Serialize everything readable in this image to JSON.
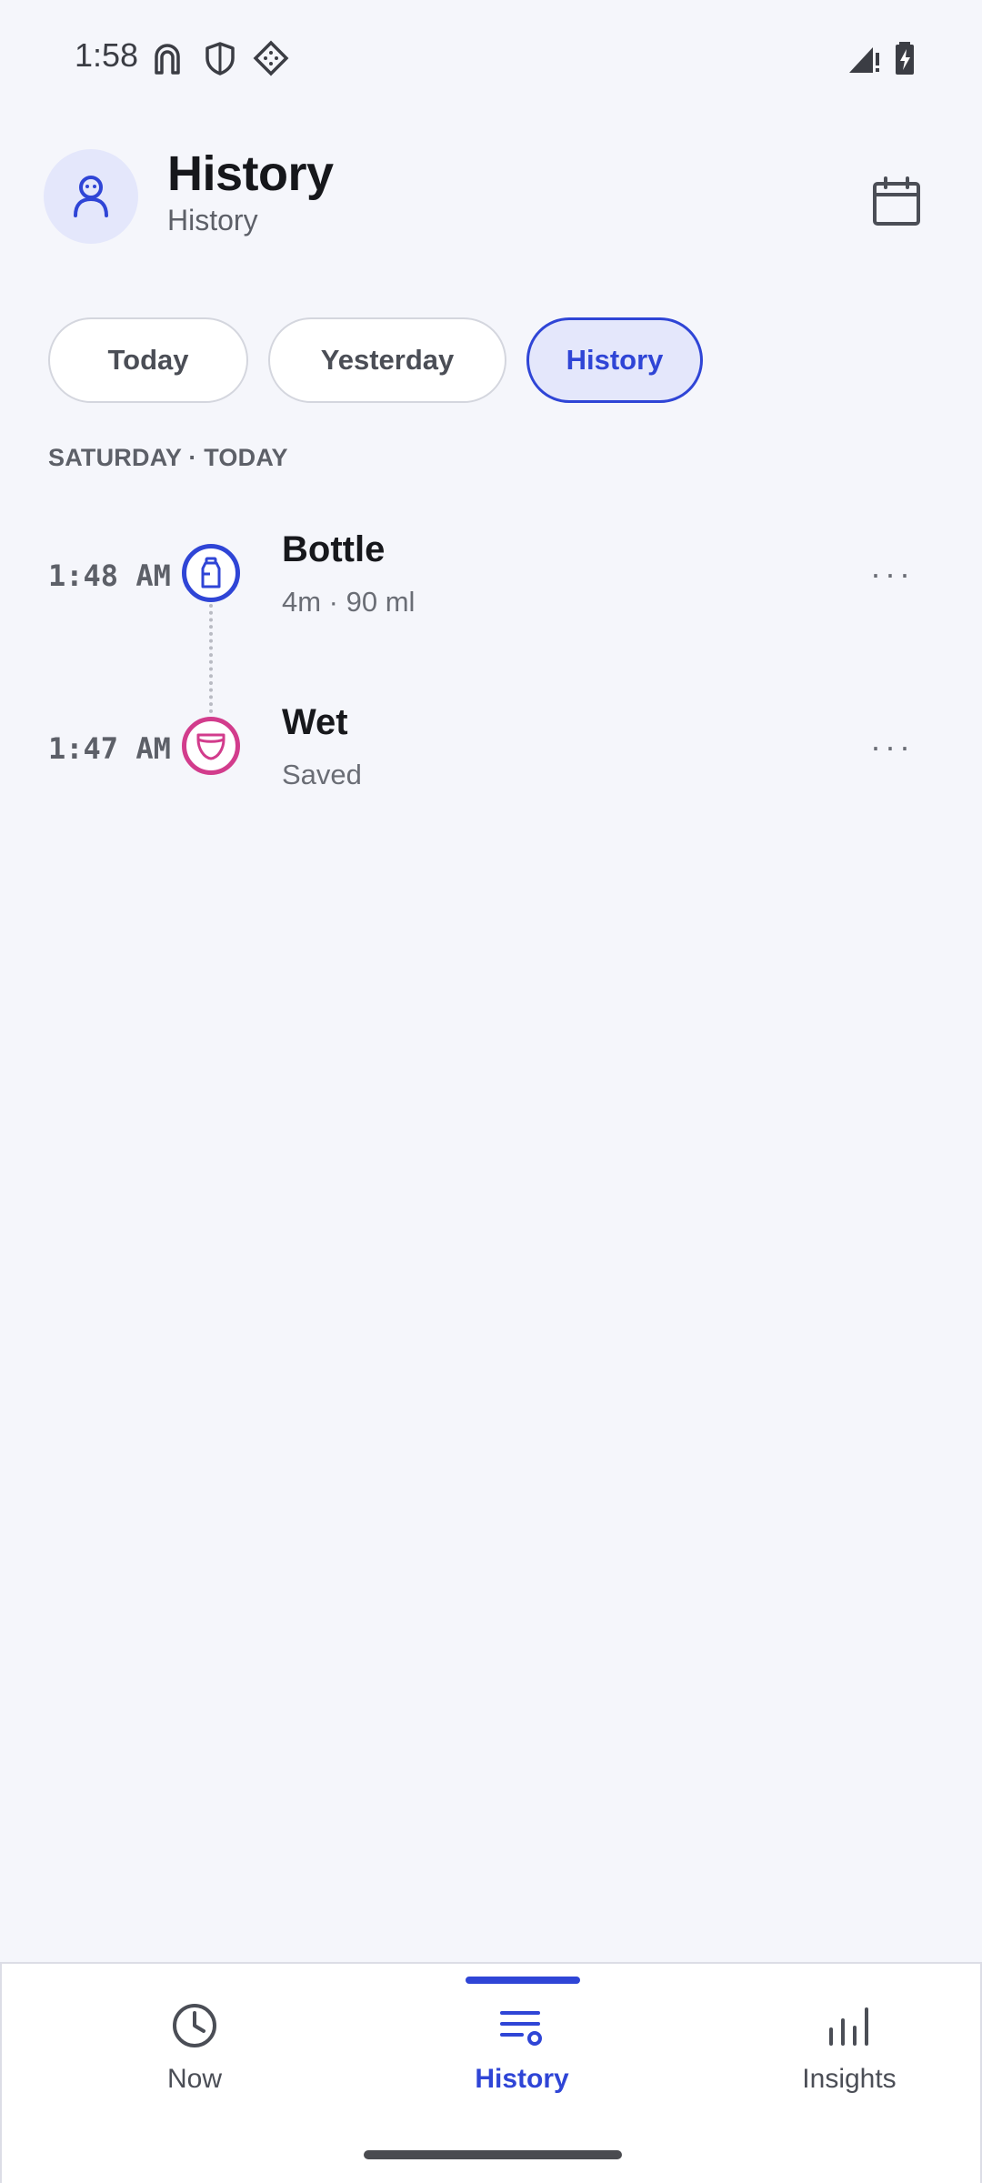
{
  "status_bar": {
    "time": "1:58",
    "icons": [
      "notification-arch-icon",
      "shield-icon",
      "diamond-dots-icon",
      "signal-icon",
      "battery-charging-icon"
    ]
  },
  "header": {
    "title": "History",
    "subtitle": "History",
    "avatar_icon": "baby-avatar-icon",
    "calendar_icon": "calendar-icon"
  },
  "filters": {
    "chips": [
      {
        "label": "Today",
        "active": false
      },
      {
        "label": "Yesterday",
        "active": false
      },
      {
        "label": "History",
        "active": true
      }
    ]
  },
  "timeline": {
    "section_title": "SATURDAY · TODAY",
    "entries": [
      {
        "time": "1:48 AM",
        "title": "Bottle",
        "detail": "4m · 90 ml",
        "icon": "bottle-icon",
        "color": "#2f45d6",
        "more": "···"
      },
      {
        "time": "1:47 AM",
        "title": "Wet",
        "detail": "Saved",
        "icon": "diaper-icon",
        "color": "#d23c8c",
        "more": "···"
      }
    ]
  },
  "bottom_nav": {
    "items": [
      {
        "label": "Now",
        "icon": "clock-icon",
        "active": false
      },
      {
        "label": "History",
        "icon": "history-list-icon",
        "active": true
      },
      {
        "label": "Insights",
        "icon": "bar-chart-icon",
        "active": false
      }
    ]
  },
  "colors": {
    "accent": "#2f45d6",
    "diaper": "#d23c8c",
    "background": "#f5f6fb"
  }
}
